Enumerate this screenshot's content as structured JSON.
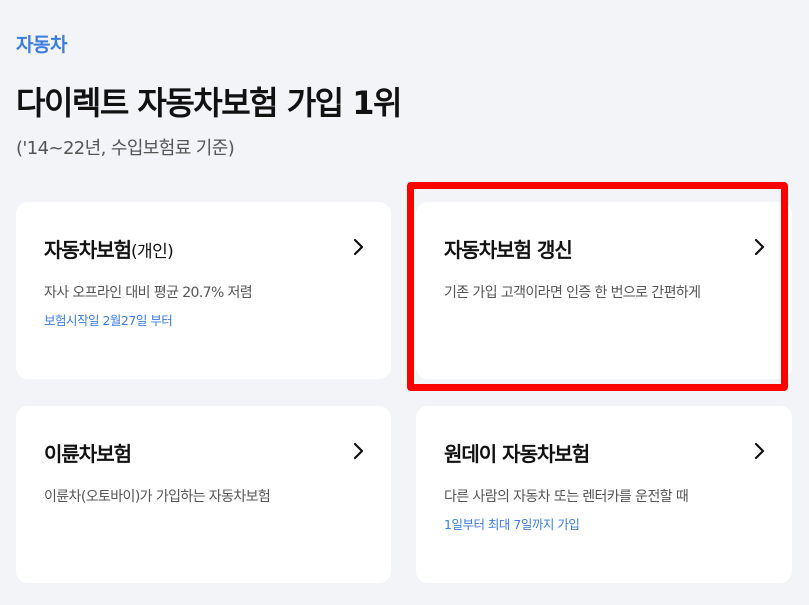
{
  "header": {
    "category": "자동차",
    "headline": "다이렉트 자동차보험 가입 1위",
    "subline": "('14~22년, 수입보험료 기준)"
  },
  "cards": [
    {
      "title": "자동차보험",
      "title_suffix": "(개인)",
      "description": "자사 오프라인 대비 평균 20.7% 저렴",
      "note": "보험시작일 2월27일 부터",
      "icon": "chevron-right-icon"
    },
    {
      "title": "자동차보험 갱신",
      "description": "기존 가입 고객이라면 인증 한 번으로 간편하게",
      "icon": "chevron-right-icon"
    },
    {
      "title": "이륜차보험",
      "description": "이륜차(오토바이)가 가입하는 자동차보험",
      "icon": "chevron-right-icon"
    },
    {
      "title": "원데이 자동차보험",
      "description": "다른 사람의 자동차 또는 렌터카를 운전할 때",
      "note": "1일부터 최대 7일까지 가입",
      "icon": "chevron-right-icon"
    }
  ],
  "colors": {
    "accent": "#3b7de0",
    "highlight": "#ff0000",
    "background": "#f3f4f7",
    "card": "#ffffff"
  }
}
